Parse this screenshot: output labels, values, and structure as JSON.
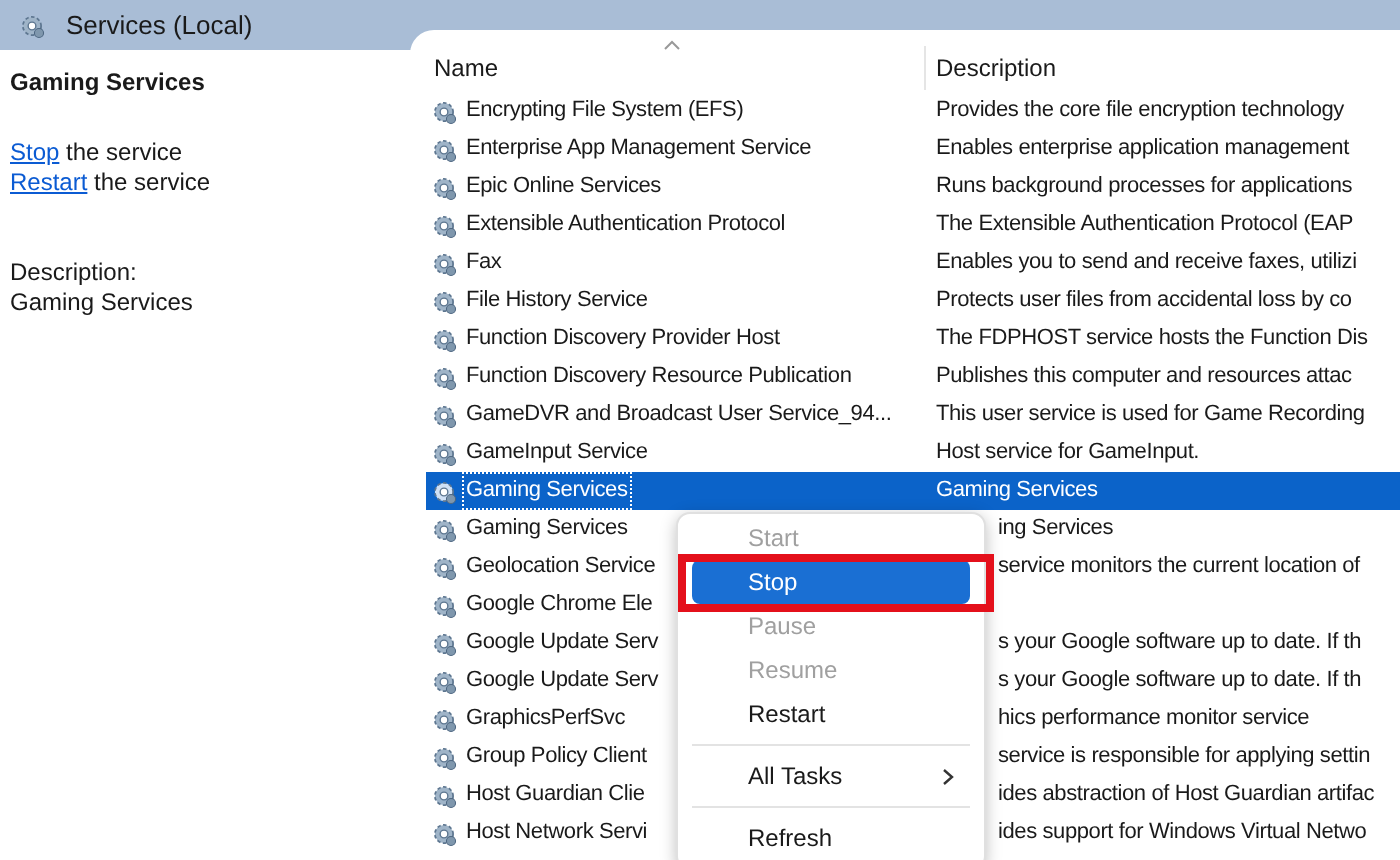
{
  "window": {
    "title": "Services (Local)"
  },
  "details": {
    "heading": "Gaming Services",
    "actions": [
      {
        "link": "Stop",
        "text": "the service"
      },
      {
        "link": "Restart",
        "text": "the service"
      }
    ],
    "description_label": "Description:",
    "description": "Gaming Services"
  },
  "table": {
    "columns": [
      "Name",
      "Description"
    ],
    "rows": [
      {
        "name": "Encrypting File System (EFS)",
        "description": "Provides the core file encryption technology",
        "selected": false,
        "covered": false
      },
      {
        "name": "Enterprise App Management Service",
        "description": "Enables enterprise application management",
        "selected": false,
        "covered": false
      },
      {
        "name": "Epic Online Services",
        "description": "Runs background processes for applications",
        "selected": false,
        "covered": false
      },
      {
        "name": "Extensible Authentication Protocol",
        "description": "The Extensible Authentication Protocol (EAP",
        "selected": false,
        "covered": false
      },
      {
        "name": "Fax",
        "description": "Enables you to send and receive faxes, utilizi",
        "selected": false,
        "covered": false
      },
      {
        "name": "File History Service",
        "description": "Protects user files from accidental loss by co",
        "selected": false,
        "covered": false
      },
      {
        "name": "Function Discovery Provider Host",
        "description": "The FDPHOST service hosts the Function Dis",
        "selected": false,
        "covered": false
      },
      {
        "name": "Function Discovery Resource Publication",
        "description": "Publishes this computer and resources attac",
        "selected": false,
        "covered": false
      },
      {
        "name": "GameDVR and Broadcast User Service_94...",
        "description": "This user service is used for Game Recording",
        "selected": false,
        "covered": false
      },
      {
        "name": "GameInput Service",
        "description": "Host service for GameInput.",
        "selected": false,
        "covered": false
      },
      {
        "name": "Gaming Services",
        "description": "Gaming Services",
        "selected": true,
        "covered": false
      },
      {
        "name": "Gaming Services",
        "description": "ing Services",
        "selected": false,
        "covered": true
      },
      {
        "name": "Geolocation Service",
        "description": "service monitors the current location of",
        "selected": false,
        "covered": true
      },
      {
        "name": "Google Chrome Ele",
        "selected": false,
        "covered": true
      },
      {
        "name": "Google Update Serv",
        "description": "s your Google software up to date. If th",
        "selected": false,
        "covered": true
      },
      {
        "name": "Google Update Serv",
        "description": "s your Google software up to date. If th",
        "selected": false,
        "covered": true
      },
      {
        "name": "GraphicsPerfSvc",
        "description": "hics performance monitor service",
        "selected": false,
        "covered": true
      },
      {
        "name": "Group Policy Client",
        "description": "service is responsible for applying settin",
        "selected": false,
        "covered": true
      },
      {
        "name": "Host Guardian Clie",
        "description": "ides abstraction of Host Guardian artifac",
        "selected": false,
        "covered": true
      },
      {
        "name": "Host Network Servi",
        "description": "ides support for Windows Virtual Netwo",
        "selected": false,
        "covered": true
      }
    ]
  },
  "context_menu": {
    "items": [
      {
        "kind": "item",
        "label": "Start",
        "disabled": true,
        "selected": false
      },
      {
        "kind": "item",
        "label": "Stop",
        "disabled": false,
        "selected": true
      },
      {
        "kind": "item",
        "label": "Pause",
        "disabled": true,
        "selected": false
      },
      {
        "kind": "item",
        "label": "Resume",
        "disabled": true,
        "selected": false
      },
      {
        "kind": "item",
        "label": "Restart",
        "disabled": false,
        "selected": false
      },
      {
        "kind": "separator"
      },
      {
        "kind": "submenu",
        "label": "All Tasks",
        "disabled": false,
        "selected": false
      },
      {
        "kind": "separator"
      },
      {
        "kind": "item",
        "label": "Refresh",
        "disabled": false,
        "selected": false
      }
    ]
  }
}
